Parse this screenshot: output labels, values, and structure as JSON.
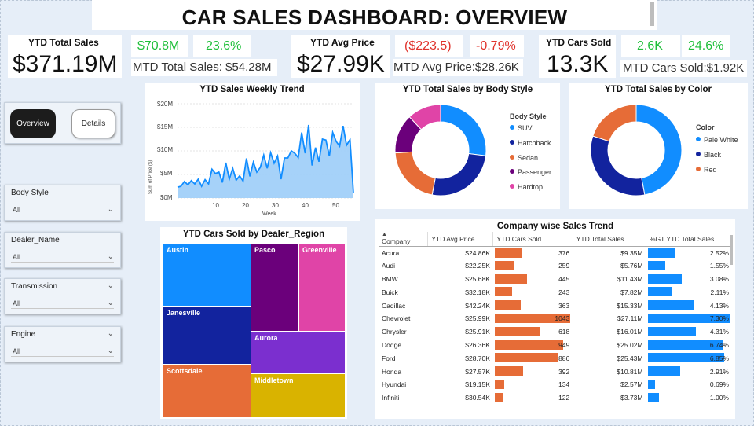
{
  "title": "CAR SALES DASHBOARD: OVERVIEW",
  "kpi": {
    "sales": {
      "label": "YTD Total Sales",
      "value": "$371.19M",
      "mtd_value": "$70.8M",
      "growth": "23.6%",
      "mtd_label": "MTD Total Sales: $54.28M"
    },
    "price": {
      "label": "YTD Avg Price",
      "value": "$27.99K",
      "mtd_value": "($223.5)",
      "growth": "-0.79%",
      "mtd_label": "MTD Avg Price:$28.26K"
    },
    "cars": {
      "label": "YTD Cars Sold",
      "value": "13.3K",
      "mtd_value": "2.6K",
      "growth": "24.6%",
      "mtd_label": "MTD Cars Sold:$1.92K"
    }
  },
  "nav": {
    "overview": "Overview",
    "details": "Details"
  },
  "slicers": [
    {
      "label": "Body Style",
      "value": "All"
    },
    {
      "label": "Dealer_Name",
      "value": "All"
    },
    {
      "label": "Transmission",
      "value": "All"
    },
    {
      "label": "Engine",
      "value": "All"
    }
  ],
  "weekly": {
    "title": "YTD Sales Weekly Trend",
    "ylabel": "Sum of Price ($)",
    "xlabel": "Week",
    "yticks": [
      "$20M",
      "$15M",
      "$10M",
      "$5M",
      "$0M"
    ],
    "xticks": [
      "10",
      "20",
      "30",
      "40",
      "50"
    ]
  },
  "body_style": {
    "title": "YTD Total Sales by Body Style",
    "legend_title": "Body Style",
    "items": [
      "SUV",
      "Hatchback",
      "Sedan",
      "Passenger",
      "Hardtop"
    ]
  },
  "color": {
    "title": "YTD Total Sales by Color",
    "legend_title": "Color",
    "items": [
      "Pale White",
      "Black",
      "Red"
    ]
  },
  "treemap": {
    "title": "YTD Cars Sold by Dealer_Region",
    "cells": [
      "Austin",
      "Pasco",
      "Greenville",
      "Janesville",
      "Aurora",
      "Scottsdale",
      "Middletown"
    ]
  },
  "company": {
    "title": "Company wise Sales Trend",
    "headers": [
      "Company",
      "YTD Avg Price",
      "YTD Cars Sold",
      "YTD Total Sales",
      "%GT YTD Total Sales"
    ],
    "rows": [
      {
        "company": "Acura",
        "avg": "$24.86K",
        "sold": "376",
        "total": "$9.35M",
        "pct": "2.52%"
      },
      {
        "company": "Audi",
        "avg": "$22.25K",
        "sold": "259",
        "total": "$5.76M",
        "pct": "1.55%"
      },
      {
        "company": "BMW",
        "avg": "$25.68K",
        "sold": "445",
        "total": "$11.43M",
        "pct": "3.08%"
      },
      {
        "company": "Buick",
        "avg": "$32.18K",
        "sold": "243",
        "total": "$7.82M",
        "pct": "2.11%"
      },
      {
        "company": "Cadillac",
        "avg": "$42.24K",
        "sold": "363",
        "total": "$15.33M",
        "pct": "4.13%"
      },
      {
        "company": "Chevrolet",
        "avg": "$25.99K",
        "sold": "1043",
        "total": "$27.11M",
        "pct": "7.30%"
      },
      {
        "company": "Chrysler",
        "avg": "$25.91K",
        "sold": "618",
        "total": "$16.01M",
        "pct": "4.31%"
      },
      {
        "company": "Dodge",
        "avg": "$26.36K",
        "sold": "949",
        "total": "$25.02M",
        "pct": "6.74%"
      },
      {
        "company": "Ford",
        "avg": "$28.70K",
        "sold": "886",
        "total": "$25.43M",
        "pct": "6.85%"
      },
      {
        "company": "Honda",
        "avg": "$27.57K",
        "sold": "392",
        "total": "$10.81M",
        "pct": "2.91%"
      },
      {
        "company": "Hyundai",
        "avg": "$19.15K",
        "sold": "134",
        "total": "$2.57M",
        "pct": "0.69%"
      },
      {
        "company": "Infiniti",
        "avg": "$30.54K",
        "sold": "122",
        "total": "$3.73M",
        "pct": "1.00%"
      }
    ]
  },
  "chart_data": [
    {
      "type": "area",
      "title": "YTD Sales Weekly Trend",
      "xlabel": "Week",
      "ylabel": "Sum of Price ($)",
      "ylim": [
        0,
        20
      ],
      "x": [
        1,
        2,
        3,
        4,
        5,
        6,
        7,
        8,
        9,
        10,
        11,
        12,
        13,
        14,
        15,
        16,
        17,
        18,
        19,
        20,
        21,
        22,
        23,
        24,
        25,
        26,
        27,
        28,
        29,
        30,
        31,
        32,
        33,
        34,
        35,
        36,
        37,
        38,
        39,
        40,
        41,
        42,
        43,
        44,
        45,
        46,
        47,
        48,
        49,
        50,
        51,
        52
      ],
      "values": [
        2.3,
        2.5,
        3.5,
        2.8,
        3.7,
        3.0,
        4.0,
        2.5,
        3.9,
        3.0,
        6.1,
        5.2,
        5.5,
        3.3,
        7.5,
        4.0,
        6.3,
        3.8,
        4.7,
        3.6,
        8.4,
        4.6,
        7.6,
        5.5,
        6.5,
        9.1,
        6.3,
        9.6,
        7.4,
        8.9,
        4.0,
        8.5,
        8.5,
        10.0,
        9.5,
        8.6,
        13.9,
        9.5,
        15.5,
        6.9,
        10.7,
        7.7,
        12.5,
        12.3,
        8.9,
        13.9,
        12.0,
        11.0,
        15.3,
        11.2,
        12.4,
        1.0
      ],
      "grid": true
    },
    {
      "type": "pie",
      "title": "YTD Total Sales by Body Style",
      "categories": [
        "SUV",
        "Hatchback",
        "Sedan",
        "Passenger",
        "Hardtop"
      ],
      "values": [
        27,
        26,
        21,
        14,
        12
      ],
      "colors": [
        "#118dff",
        "#12239e",
        "#e66c37",
        "#6b007b",
        "#e044a7"
      ]
    },
    {
      "type": "pie",
      "title": "YTD Total Sales by Color",
      "categories": [
        "Pale White",
        "Black",
        "Red"
      ],
      "values": [
        47,
        33,
        20
      ],
      "colors": [
        "#118dff",
        "#12239e",
        "#e66c37"
      ]
    },
    {
      "type": "bar",
      "title": "Company wise Sales Trend",
      "categories": [
        "Acura",
        "Audi",
        "BMW",
        "Buick",
        "Cadillac",
        "Chevrolet",
        "Chrysler",
        "Dodge",
        "Ford",
        "Honda",
        "Hyundai",
        "Infiniti"
      ],
      "series": [
        {
          "name": "YTD Cars Sold",
          "values": [
            376,
            259,
            445,
            243,
            363,
            1043,
            618,
            949,
            886,
            392,
            134,
            122
          ]
        },
        {
          "name": "%GT YTD Total Sales",
          "values": [
            2.52,
            1.55,
            3.08,
            2.11,
            4.13,
            7.3,
            4.31,
            6.74,
            6.85,
            2.91,
            0.69,
            1.0
          ]
        }
      ]
    }
  ],
  "colors": {
    "accent_blue": "#118dff",
    "navy": "#12239e",
    "orange": "#e66c37",
    "purple": "#6b007b",
    "pink": "#e044a7",
    "green": "#1fbf3a",
    "red": "#e0322b",
    "treemap_magenta": "#7b2fcf",
    "treemap_yellow": "#d9b300"
  }
}
